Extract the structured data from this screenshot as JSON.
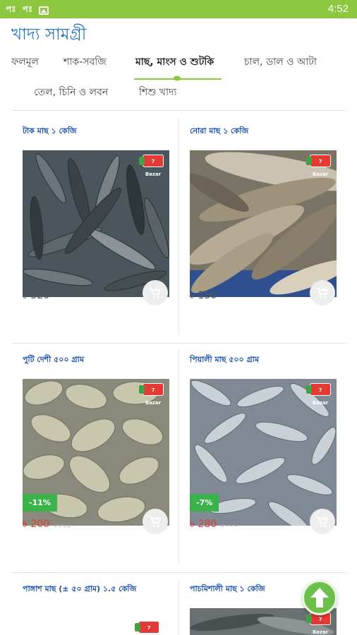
{
  "status_bar": {
    "time": "4:52",
    "left_icons": [
      "pb-icon",
      "pb-icon",
      "image-icon"
    ],
    "left_labels": [
      "পঃ",
      "পঃ"
    ],
    "color": "#8dc63f"
  },
  "page": {
    "title": "খাদ্য সামগ্রী"
  },
  "tabs": [
    {
      "label": "ফলমূল",
      "active": false
    },
    {
      "label": "শাক-সবজি",
      "active": false
    },
    {
      "label": "মাছ, মাংস ও শুটকি",
      "active": true
    },
    {
      "label": "চাল, ডাল ও আটা",
      "active": false
    },
    {
      "label": "তেল, চিনি ও লবন",
      "active": false
    },
    {
      "label": "শিশু খাদ্য",
      "active": false
    }
  ],
  "products": [
    {
      "name": "টাক মাছ ১ কেজি",
      "price": "৳ 520",
      "old_price": "",
      "discount": "",
      "on_sale": false,
      "cart_icon": "add-cart-icon"
    },
    {
      "name": "নোরা মাছ ১ কেজি",
      "price": "৳ 150",
      "old_price": "",
      "discount": "",
      "on_sale": false,
      "cart_icon": "add-cart-icon"
    },
    {
      "name": "পুটি দেশী ৫০০ গ্রাম",
      "price": "৳ 200",
      "old_price": "৳২২৫",
      "discount": "-11%",
      "on_sale": true,
      "cart_icon": "add-cart-icon"
    },
    {
      "name": "পিয়ালী মাছ ৫০০ গ্রাম",
      "price": "৳ 280",
      "old_price": "৳৩০০",
      "discount": "-7%",
      "on_sale": true,
      "cart_icon": "add-cart-icon"
    },
    {
      "name": "পাঙ্গাশ মাছ (± ৫০ গ্রাম) ১.৫ কেজি",
      "price": "",
      "old_price": "",
      "discount": "",
      "on_sale": false
    },
    {
      "name": "পাচমিশালী মাছ ১ কেজি",
      "price": "",
      "old_price": "",
      "discount": "",
      "on_sale": false
    }
  ],
  "badge_label": "7 Bazar",
  "fab": {
    "icon": "arrow-up-icon"
  },
  "colors": {
    "brand_green": "#8dc63f",
    "title_blue": "#1a6fcf",
    "product_title_blue": "#1a4fa8",
    "sale_red": "#e53935",
    "discount_green": "#3cb34a"
  }
}
